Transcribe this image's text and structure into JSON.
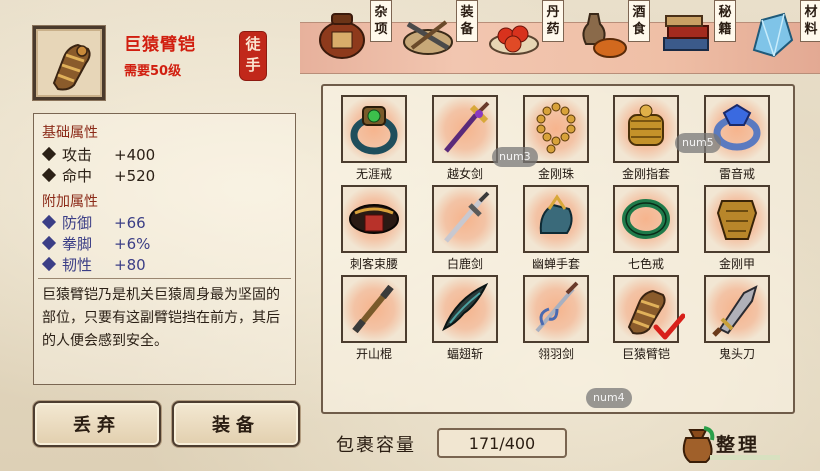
{
  "item": {
    "name": "巨猿臂铠",
    "requirement": "需要50级",
    "seal": "徒手"
  },
  "tabs": [
    {
      "label": "杂项",
      "icon": "wine-jar-icon"
    },
    {
      "label": "装备",
      "icon": "scroll-weapons-icon"
    },
    {
      "label": "丹药",
      "icon": "red-pills-icon"
    },
    {
      "label": "酒食",
      "icon": "food-wine-icon"
    },
    {
      "label": "秘籍",
      "icon": "books-icon"
    },
    {
      "label": "材料",
      "icon": "crystal-icon"
    }
  ],
  "stats": {
    "base_title": "基础属性",
    "base": [
      {
        "name": "攻击",
        "value": "+400"
      },
      {
        "name": "命中",
        "value": "+520"
      }
    ],
    "bonus_title": "附加属性",
    "bonus": [
      {
        "name": "防御",
        "value": "+66"
      },
      {
        "name": "拳脚",
        "value": "+6%"
      },
      {
        "name": "韧性",
        "value": "+80"
      }
    ],
    "description": "巨猿臂铠乃是机关巨猿周身最为坚固的部位，只要有这副臂铠挡在前方，其后的人便会感到安全。"
  },
  "buttons": {
    "discard": "丢弃",
    "equip": "装备"
  },
  "inventory": {
    "items": [
      {
        "label": "无涯戒",
        "icon": "ring-green-gem-icon"
      },
      {
        "label": "越女剑",
        "icon": "purple-sword-icon"
      },
      {
        "label": "金刚珠",
        "icon": "bead-necklace-icon"
      },
      {
        "label": "金刚指套",
        "icon": "golden-knuckle-icon"
      },
      {
        "label": "雷音戒",
        "icon": "blue-gem-ring-icon"
      },
      {
        "label": "刺客束腰",
        "icon": "belt-icon"
      },
      {
        "label": "白鹿剑",
        "icon": "white-sword-icon"
      },
      {
        "label": "幽蝉手套",
        "icon": "cicada-glove-icon"
      },
      {
        "label": "七色戒",
        "icon": "jade-ring-icon"
      },
      {
        "label": "金刚甲",
        "icon": "golden-armor-icon"
      },
      {
        "label": "开山棍",
        "icon": "staff-icon"
      },
      {
        "label": "蝠翅斩",
        "icon": "bat-blade-icon"
      },
      {
        "label": "翎羽剑",
        "icon": "feather-sword-icon"
      },
      {
        "label": "巨猿臂铠",
        "icon": "gauntlet-icon",
        "equipped": true
      },
      {
        "label": "鬼头刀",
        "icon": "broadsword-icon"
      }
    ],
    "overlays": [
      "num3",
      "num5",
      "num4"
    ]
  },
  "capacity": {
    "label": "包裹容量",
    "value": "171/400"
  },
  "sort_label": "整理",
  "colors": {
    "item_name": "#d11e0f",
    "bonus_stat": "#3b3e86",
    "seal": "#c1281a"
  }
}
